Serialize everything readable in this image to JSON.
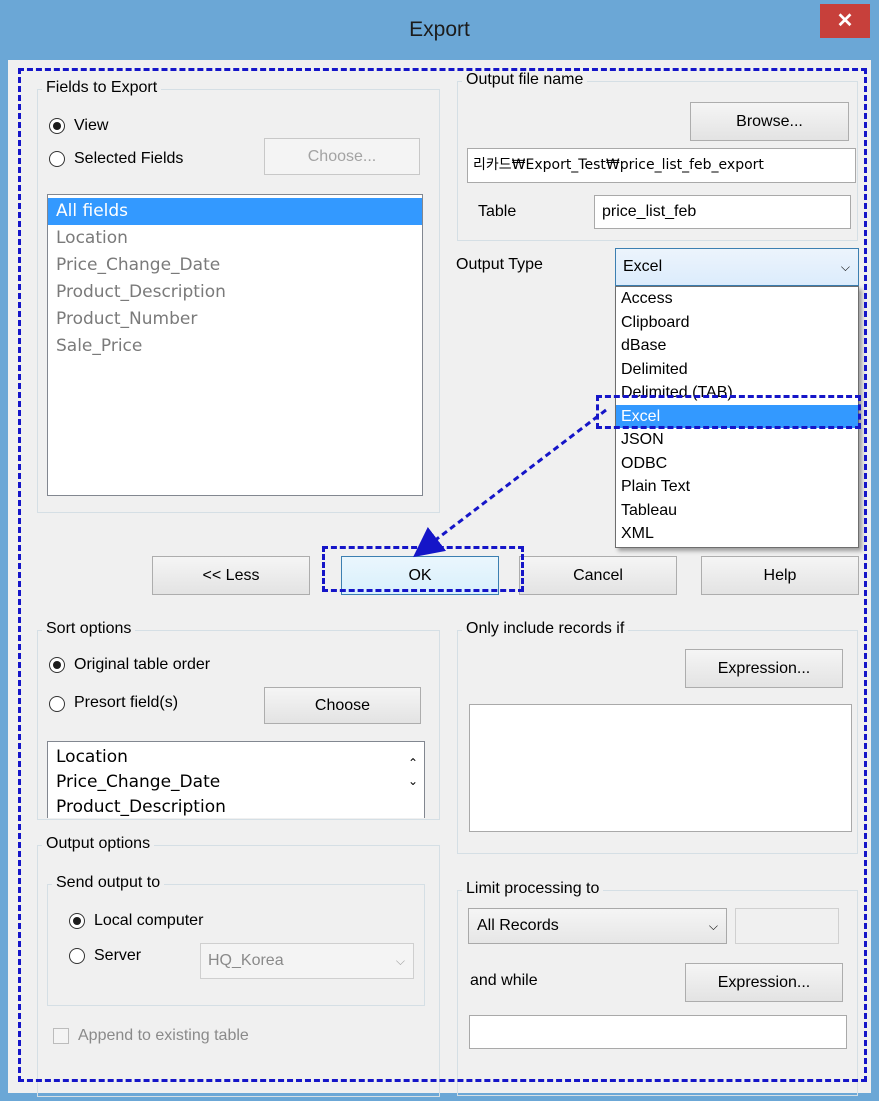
{
  "window": {
    "title": "Export",
    "close_glyph": "✕"
  },
  "fields_group": {
    "title": "Fields to Export",
    "view_label": "View",
    "selected_label": "Selected Fields",
    "choose_label": "Choose...",
    "fields": [
      "All fields",
      "Location",
      "Price_Change_Date",
      "Product_Description",
      "Product_Number",
      "Sale_Price"
    ]
  },
  "output_group": {
    "title": "Output file name",
    "browse_label": "Browse...",
    "file_path": "리카드₩Export_Test₩price_list_feb_export",
    "table_label": "Table",
    "table_value": "price_list_feb"
  },
  "output_type": {
    "label": "Output Type",
    "selected": "Excel",
    "options": [
      "Access",
      "Clipboard",
      "dBase",
      "Delimited",
      "Delimited (TAB)",
      "Excel",
      "JSON",
      "ODBC",
      "Plain Text",
      "Tableau",
      "XML"
    ]
  },
  "buttons": {
    "less": "<< Less",
    "ok": "OK",
    "cancel": "Cancel",
    "help": "Help"
  },
  "sort_group": {
    "title": "Sort options",
    "original_label": "Original table order",
    "presort_label": "Presort field(s)",
    "choose_label": "Choose",
    "fields": [
      "Location",
      "Price_Change_Date",
      "Product_Description"
    ]
  },
  "only_include": {
    "title": "Only include records if",
    "expression_label": "Expression..."
  },
  "output_options": {
    "title": "Output options",
    "send_title": "Send output to",
    "local_label": "Local computer",
    "server_label": "Server",
    "server_value": "HQ_Korea",
    "append_label": "Append to existing table"
  },
  "limit": {
    "title": "Limit processing to",
    "selected": "All Records",
    "and_while_label": "and while",
    "expression_label": "Expression..."
  },
  "colors": {
    "highlight": "#3399ff",
    "annotation": "#1515c8",
    "frame": "#6ba7d6",
    "close": "#c7403b"
  }
}
